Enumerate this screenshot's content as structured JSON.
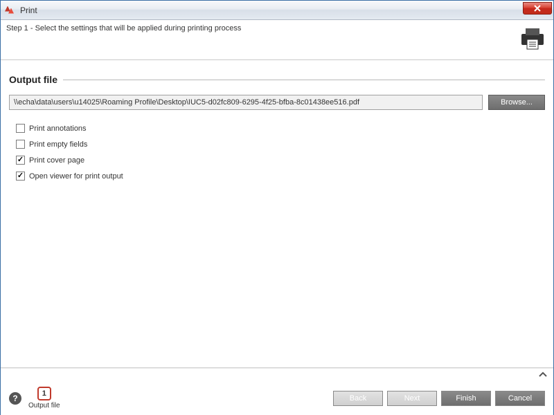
{
  "window": {
    "title": "Print"
  },
  "header": {
    "step_text": "Step 1 - Select the settings that will be applied during printing process"
  },
  "section": {
    "title": "Output file",
    "file_path": "\\\\echa\\data\\users\\u14025\\Roaming Profile\\Desktop\\IUC5-d02fc809-6295-4f25-bfba-8c01438ee516.pdf",
    "browse_label": "Browse..."
  },
  "options": {
    "print_annotations": {
      "label": "Print annotations",
      "checked": false
    },
    "print_empty_fields": {
      "label": "Print empty fields",
      "checked": false
    },
    "print_cover_page": {
      "label": "Print cover page",
      "checked": true
    },
    "open_viewer": {
      "label": "Open viewer for print output",
      "checked": true
    }
  },
  "footer": {
    "step_number": "1",
    "step_label": "Output file",
    "buttons": {
      "back": "Back",
      "next": "Next",
      "finish": "Finish",
      "cancel": "Cancel"
    }
  }
}
